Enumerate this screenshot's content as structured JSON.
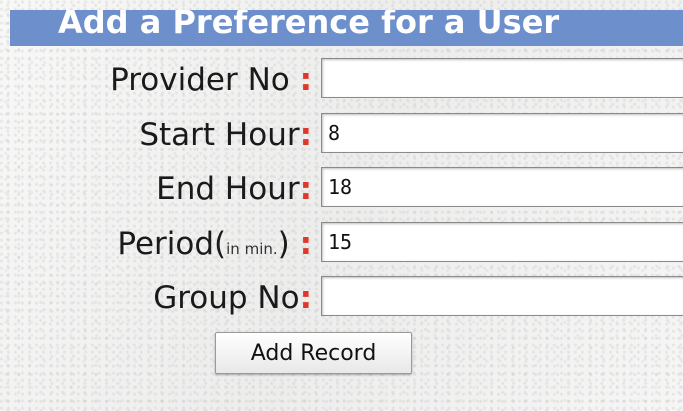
{
  "header": {
    "title": "Add a Preference for a User"
  },
  "form": {
    "provider_no": {
      "label": "Provider No ",
      "colon": ":",
      "value": ""
    },
    "start_hour": {
      "label": "Start Hour",
      "colon": ":",
      "value": "8"
    },
    "end_hour": {
      "label": "End Hour",
      "colon": ":",
      "value": "18"
    },
    "period": {
      "label": "Period(",
      "unit": "in min.",
      "label_end": ") ",
      "colon": ":",
      "value": "15"
    },
    "group_no": {
      "label": "Group No",
      "colon": ":",
      "value": ""
    },
    "submit_label": "Add Record"
  },
  "colors": {
    "header_bg": "#6d8fcb",
    "colon": "#e0372b"
  }
}
